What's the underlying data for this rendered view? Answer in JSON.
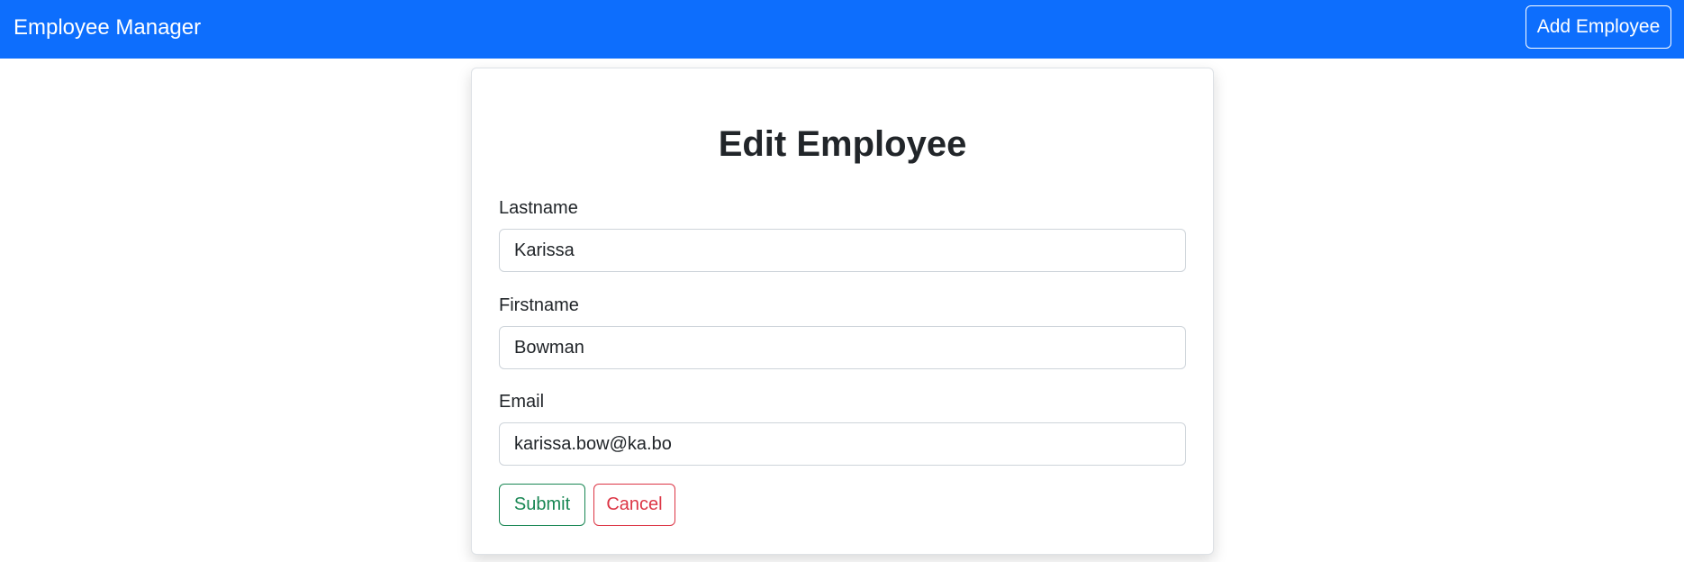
{
  "navbar": {
    "brand": "Employee Manager",
    "add_button_label": "Add Employee"
  },
  "form": {
    "title": "Edit Employee",
    "fields": [
      {
        "label": "Lastname",
        "value": "Karissa"
      },
      {
        "label": "Firstname",
        "value": "Bowman"
      },
      {
        "label": "Email",
        "value": "karissa.bow@ka.bo"
      }
    ],
    "submit_label": "Submit",
    "cancel_label": "Cancel"
  },
  "colors": {
    "navbar": "#0d6efd",
    "submit": "#198754",
    "cancel": "#dc3545"
  }
}
